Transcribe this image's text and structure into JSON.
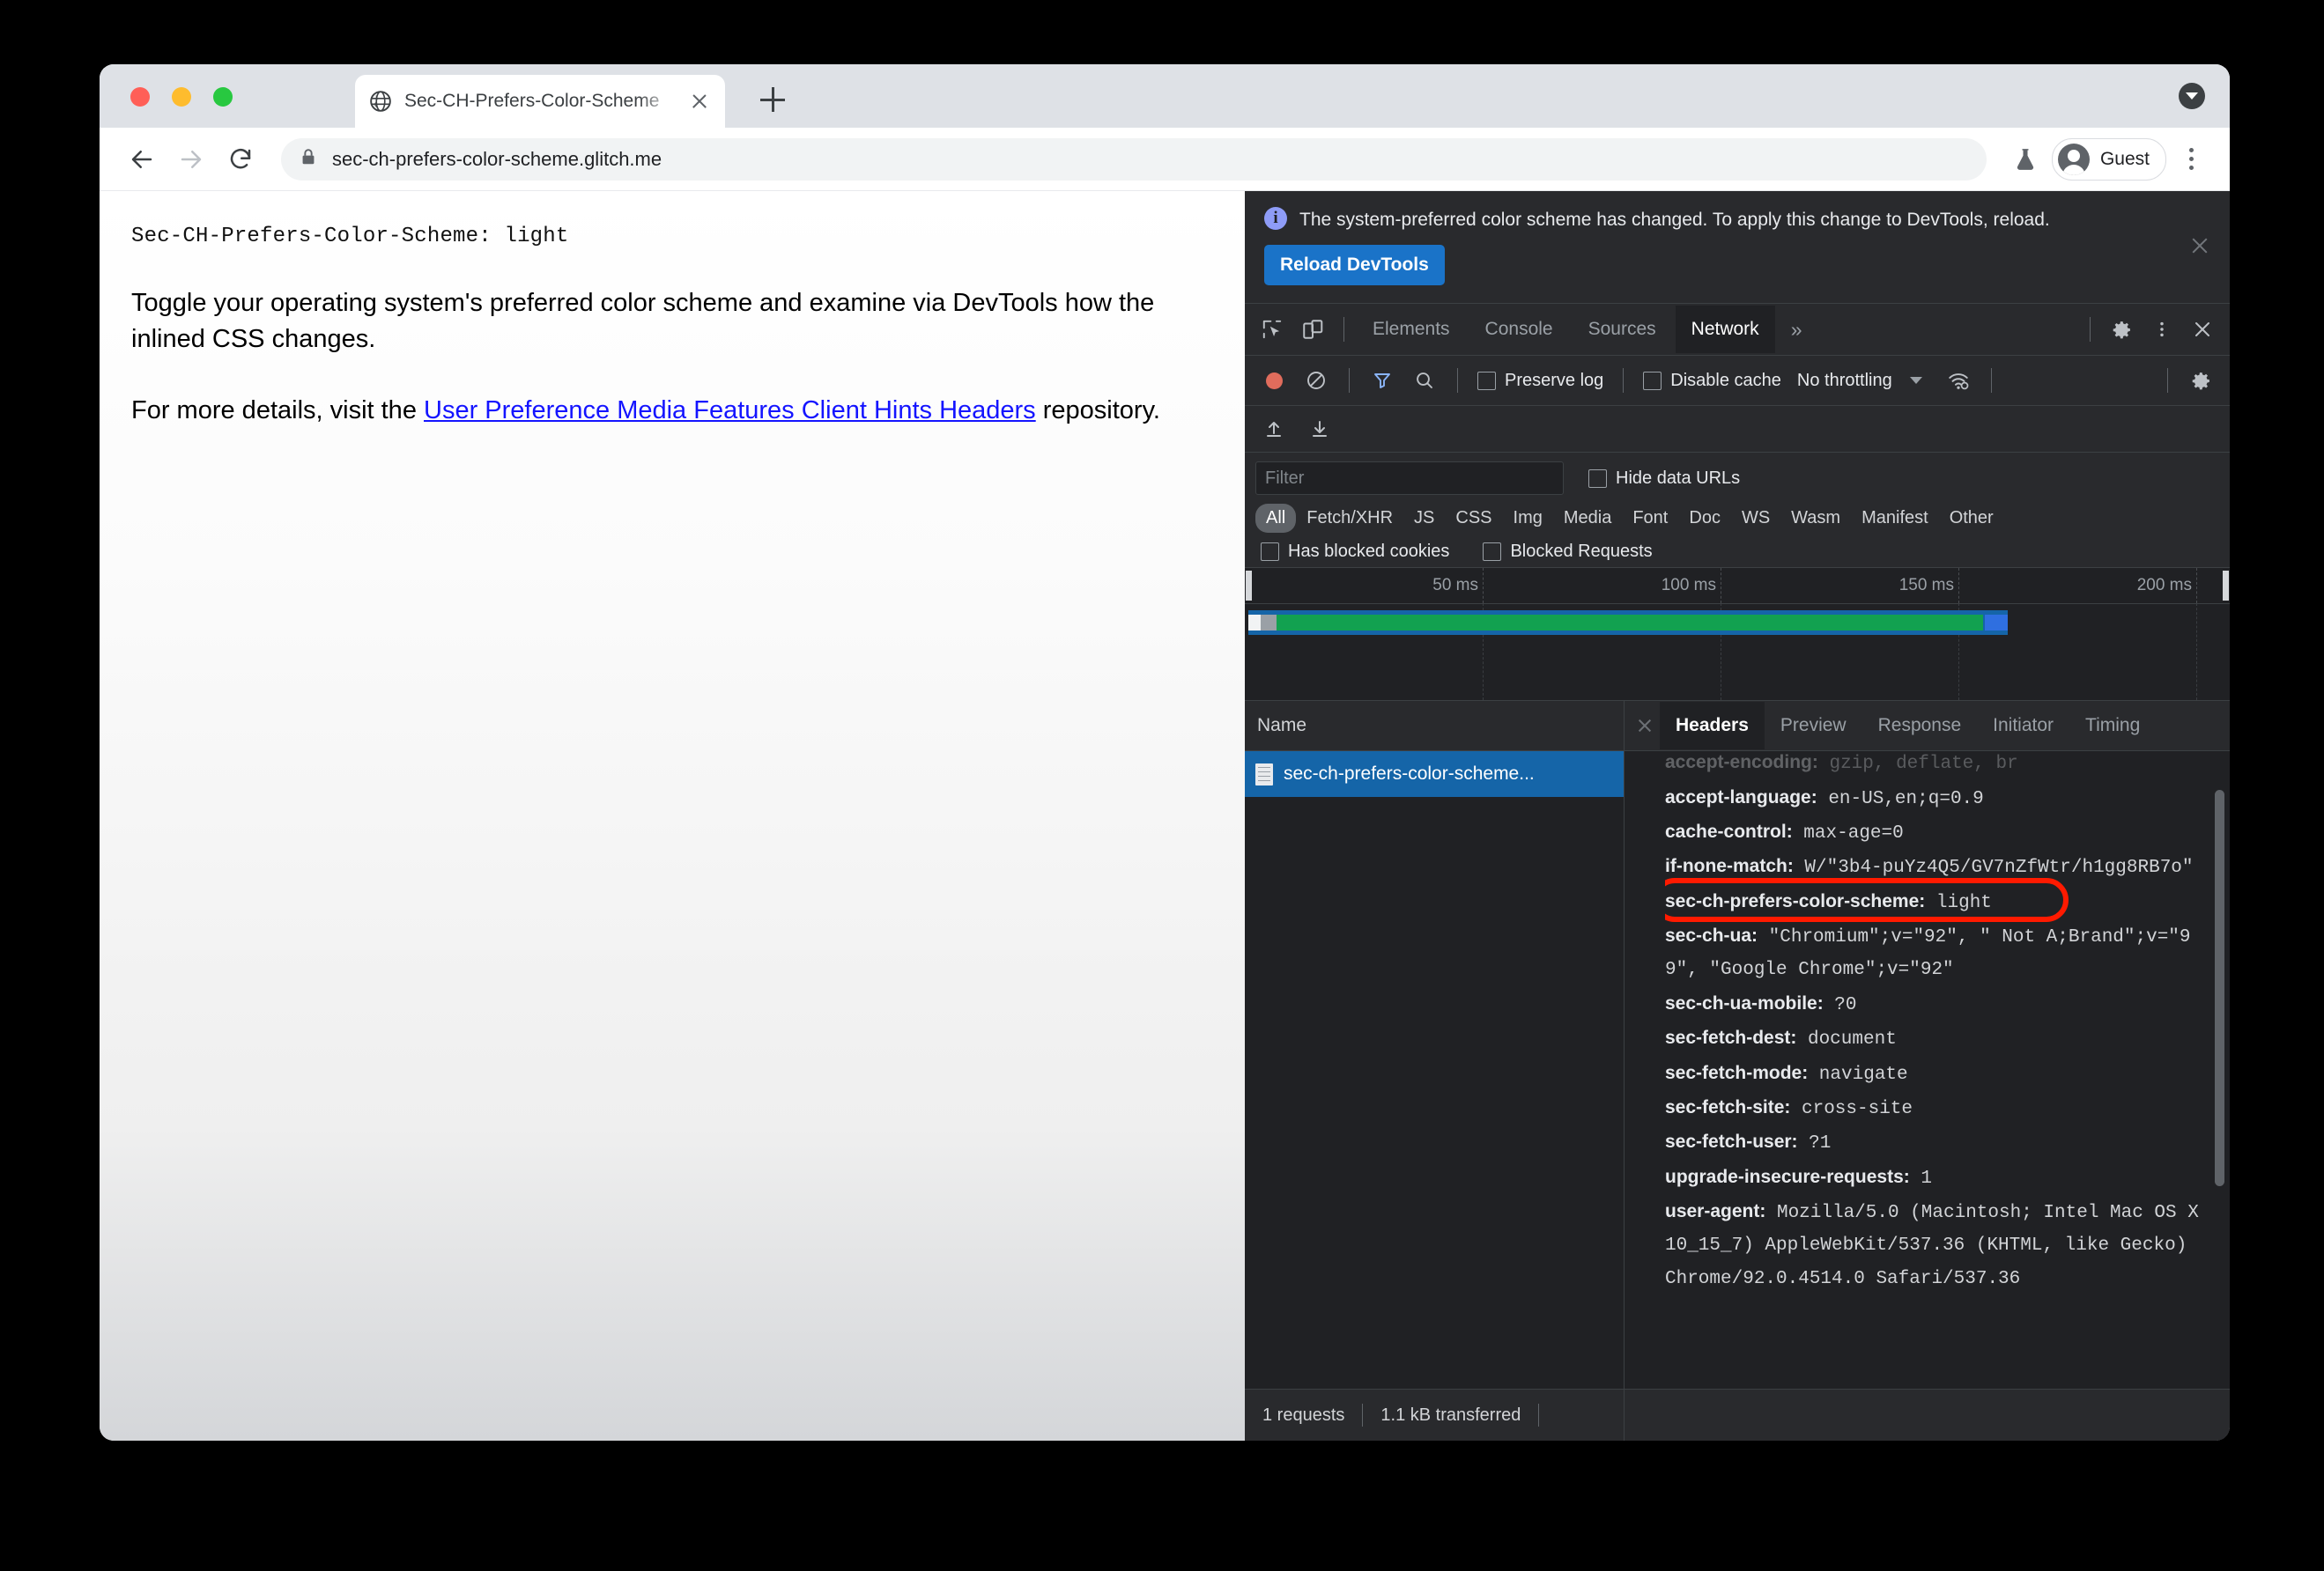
{
  "browser": {
    "tab": {
      "title": "Sec-CH-Prefers-Color-Scheme",
      "favicon": "globe-icon",
      "close": "close-icon"
    },
    "new_tab_label": "+",
    "omnibox": {
      "url": "sec-ch-prefers-color-scheme.glitch.me",
      "lock": "lock-icon"
    },
    "profile_label": "Guest",
    "nav": {
      "back": "back-arrow-icon",
      "forward": "forward-arrow-icon",
      "reload": "reload-icon"
    }
  },
  "page": {
    "header_line": "Sec-CH-Prefers-Color-Scheme: light",
    "paragraph1": "Toggle your operating system's preferred color scheme and examine via DevTools how the inlined CSS changes.",
    "paragraph2_prefix": "For more details, visit the ",
    "link_text": "User Preference Media Features Client Hints Headers",
    "paragraph2_suffix": " repository."
  },
  "devtools": {
    "notice": {
      "text": "The system-preferred color scheme has changed. To apply this change to DevTools, reload.",
      "button": "Reload DevTools",
      "icon": "info-icon",
      "close": "close-icon"
    },
    "panel_tabs": [
      "Elements",
      "Console",
      "Sources",
      "Network"
    ],
    "active_panel": "Network",
    "more_panels": "»",
    "toolbar": {
      "record": "record-icon",
      "clear": "clear-icon",
      "filter": "filter-icon",
      "search": "search-icon",
      "preserve_log": "Preserve log",
      "disable_cache": "Disable cache",
      "throttling": "No throttling",
      "settings": "gear-icon",
      "import": "import-icon",
      "export": "export-icon"
    },
    "filter": {
      "placeholder": "Filter",
      "hide_data_urls": "Hide data URLs",
      "types": [
        "All",
        "Fetch/XHR",
        "JS",
        "CSS",
        "Img",
        "Media",
        "Font",
        "Doc",
        "WS",
        "Wasm",
        "Manifest",
        "Other"
      ],
      "active_type": "All",
      "has_blocked_cookies": "Has blocked cookies",
      "blocked_requests": "Blocked Requests"
    },
    "overview": {
      "ticks": [
        "50 ms",
        "100 ms",
        "150 ms",
        "200 ms"
      ]
    },
    "requests": {
      "column_header": "Name",
      "rows": [
        {
          "name": "sec-ch-prefers-color-scheme...",
          "icon": "document-icon"
        }
      ]
    },
    "detail_tabs": [
      "Headers",
      "Preview",
      "Response",
      "Initiator",
      "Timing"
    ],
    "active_detail_tab": "Headers",
    "headers": [
      {
        "key": "accept-encoding:",
        "value": " gzip, deflate, br",
        "clipped": true
      },
      {
        "key": "accept-language:",
        "value": " en-US,en;q=0.9"
      },
      {
        "key": "cache-control:",
        "value": " max-age=0"
      },
      {
        "key": "if-none-match:",
        "value": " W/\"3b4-puYz4Q5/GV7nZfWtr/h1gg8RB7o\""
      },
      {
        "key": "sec-ch-prefers-color-scheme:",
        "value": " light",
        "highlighted": true
      },
      {
        "key": "sec-ch-ua:",
        "value": " \"Chromium\";v=\"92\", \" Not A;Brand\";v=\"99\", \"Google Chrome\";v=\"92\""
      },
      {
        "key": "sec-ch-ua-mobile:",
        "value": " ?0"
      },
      {
        "key": "sec-fetch-dest:",
        "value": " document"
      },
      {
        "key": "sec-fetch-mode:",
        "value": " navigate"
      },
      {
        "key": "sec-fetch-site:",
        "value": " cross-site"
      },
      {
        "key": "sec-fetch-user:",
        "value": " ?1"
      },
      {
        "key": "upgrade-insecure-requests:",
        "value": " 1"
      },
      {
        "key": "user-agent:",
        "value": " Mozilla/5.0 (Macintosh; Intel Mac OS X 10_15_7) AppleWebKit/537.36 (KHTML, like Gecko) Chrome/92.0.4514.0 Safari/537.36"
      }
    ],
    "status": {
      "requests": "1 requests",
      "transferred": "1.1 kB transferred"
    }
  },
  "colors": {
    "accent_blue": "#1a73c8",
    "highlight_ring": "#ff1a00",
    "devtools_bg": "#202124",
    "devtools_panel": "#292a2d",
    "link": "#1414ff"
  }
}
